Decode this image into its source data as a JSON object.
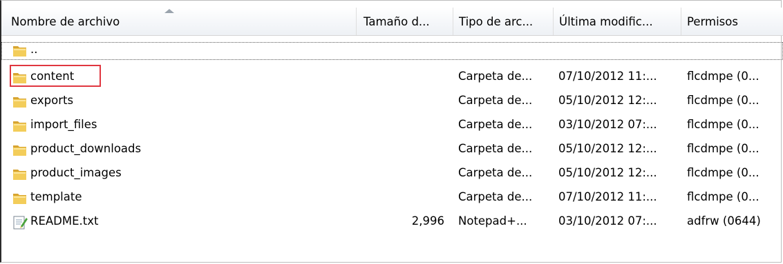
{
  "columns": {
    "name": "Nombre de archivo",
    "size": "Tamaño d...",
    "type": "Tipo de arc...",
    "modified": "Última modific...",
    "permissions": "Permisos"
  },
  "rows": [
    {
      "name": "..",
      "size": "",
      "type": "",
      "modified": "",
      "permissions": "",
      "icon": "folder-icon"
    },
    {
      "name": "content",
      "size": "",
      "type": "Carpeta de...",
      "modified": "07/10/2012 11:...",
      "permissions": "flcdmpe (0...",
      "icon": "folder-icon"
    },
    {
      "name": "exports",
      "size": "",
      "type": "Carpeta de...",
      "modified": "05/10/2012 12:...",
      "permissions": "flcdmpe (0...",
      "icon": "folder-icon"
    },
    {
      "name": "import_files",
      "size": "",
      "type": "Carpeta de...",
      "modified": "03/10/2012 07:...",
      "permissions": "flcdmpe (0...",
      "icon": "folder-icon"
    },
    {
      "name": "product_downloads",
      "size": "",
      "type": "Carpeta de...",
      "modified": "05/10/2012 12:...",
      "permissions": "flcdmpe (0...",
      "icon": "folder-icon"
    },
    {
      "name": "product_images",
      "size": "",
      "type": "Carpeta de...",
      "modified": "05/10/2012 12:...",
      "permissions": "flcdmpe (0...",
      "icon": "folder-icon"
    },
    {
      "name": "template",
      "size": "",
      "type": "Carpeta de...",
      "modified": "07/10/2012 11:...",
      "permissions": "flcdmpe (0...",
      "icon": "folder-icon"
    },
    {
      "name": "README.txt",
      "size": "2,996",
      "type": "Notepad+...",
      "modified": "03/10/2012 07:...",
      "permissions": "adfrw (0644)",
      "icon": "text-file-icon"
    }
  ],
  "highlight": {
    "color": "#e0363f",
    "target": "content"
  }
}
